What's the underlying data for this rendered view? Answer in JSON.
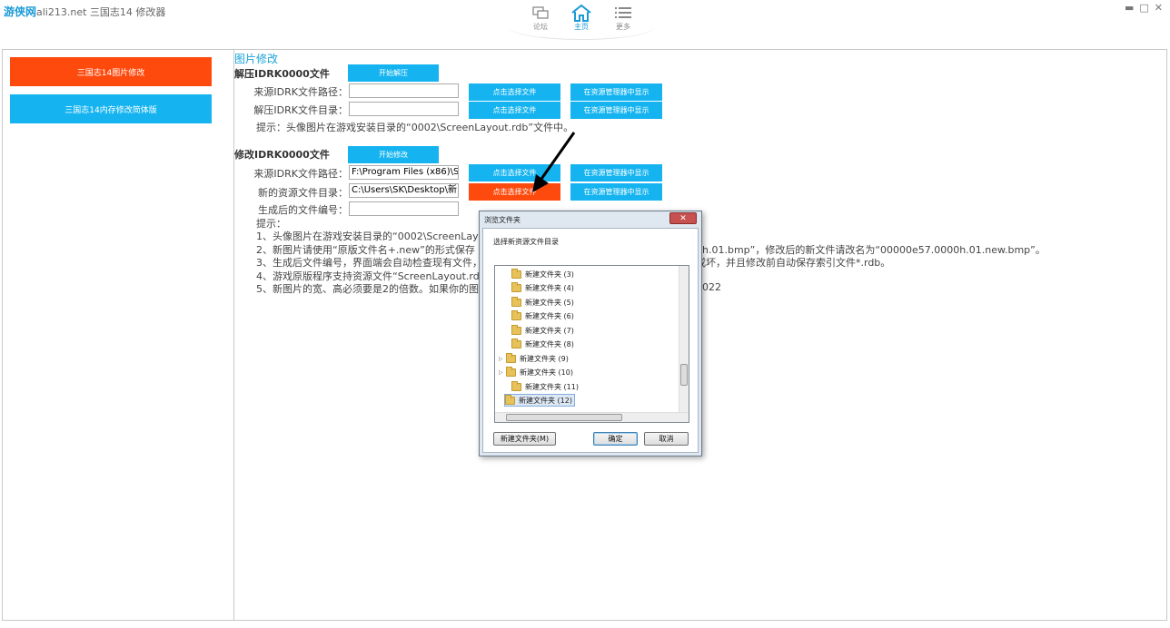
{
  "app": {
    "logo": "游侠网",
    "title": "ali213.net 三国志14 修改器",
    "window_controls": [
      "▬",
      "□",
      "✕"
    ]
  },
  "nav": [
    {
      "label": "论坛",
      "icon": "forum-icon"
    },
    {
      "label": "主页",
      "icon": "home-icon",
      "active": true
    },
    {
      "label": "更多",
      "icon": "list-icon"
    }
  ],
  "sidebar": {
    "items": [
      {
        "label": "三国志14图片修改",
        "color": "#ff4a0d"
      },
      {
        "label": "三国志14内存修改简体版",
        "color": "#15b4f0"
      }
    ]
  },
  "main": {
    "section_title": "图片修改",
    "unpack": {
      "title": "解压IDRK0000文件",
      "start_button": "开始解压",
      "source_label": "来源IDRK文件路径：",
      "source_value": "",
      "dest_label": "解压IDRK文件目录：",
      "dest_value": "",
      "choose_button": "点击选择文件",
      "explorer_button": "在资源管理器中显示",
      "tip": "提示：头像图片在游戏安装目录的“0002\\ScreenLayout.rdb”文件中。"
    },
    "modify": {
      "title": "修改IDRK0000文件",
      "start_button": "开始修改",
      "source_label": "来源IDRK文件路径：",
      "source_value": "F:\\Program Files (x86)\\S",
      "newres_label": "新的资源文件目录：",
      "newres_value": "C:\\Users\\SK\\Desktop\\新",
      "number_label": "生成后的文件编号：",
      "number_value": "",
      "choose_button": "点击选择文件",
      "explorer_button": "在资源管理器中显示",
      "tips_header": "提示：",
      "tips": [
        "1、头像图片在游戏安装目录的“0002\\ScreenLayo",
        "2、新图片请使用“原版文件名+.new”的形式保存",
        "3、生成后文件编号，界面端会自动检查现有文件，",
        "4、游戏原版程序支持资源文件“ScreenLayout.rdb",
        "5、新图片的宽、高必须要是2的倍数。如果你的图片"
      ],
      "tips_right": [
        "0h.01.bmp”，修改后的新文件请改名为“00000e57.0000h.01.new.bmp”。",
        "或坏，并且修改前自动保存索引文件*.rdb。",
        "1022"
      ]
    }
  },
  "dialog": {
    "title": "浏览文件夹",
    "close": "✕",
    "description": "选择新资源文件目录",
    "folders": [
      {
        "label": "新建文件夹 (3)",
        "expandable": false
      },
      {
        "label": "新建文件夹 (4)",
        "expandable": false
      },
      {
        "label": "新建文件夹 (5)",
        "expandable": false
      },
      {
        "label": "新建文件夹 (6)",
        "expandable": false
      },
      {
        "label": "新建文件夹 (7)",
        "expandable": false
      },
      {
        "label": "新建文件夹 (8)",
        "expandable": false
      },
      {
        "label": "新建文件夹 (9)",
        "expandable": true
      },
      {
        "label": "新建文件夹 (10)",
        "expandable": true
      },
      {
        "label": "新建文件夹 (11)",
        "expandable": false
      },
      {
        "label": "新建文件夹 (12)",
        "expandable": false,
        "selected": true
      }
    ],
    "new_folder_button": "新建文件夹(M)",
    "ok_button": "确定",
    "cancel_button": "取消"
  },
  "colors": {
    "accent_blue": "#15b4f0",
    "accent_orange": "#ff4a0d",
    "link_blue": "#1aa3d9"
  }
}
